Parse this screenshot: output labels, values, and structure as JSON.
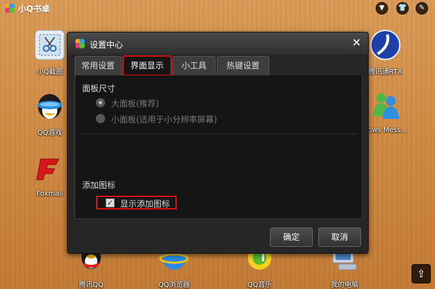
{
  "app": {
    "title": "小Q书桌"
  },
  "titlebar": {
    "icons": [
      "chevron-down-icon",
      "shirt-icon",
      "edit-icon"
    ]
  },
  "desktop": {
    "icons": [
      {
        "label": "小Q截图",
        "icon": "screenshot-icon"
      },
      {
        "label": "QQ游戏",
        "icon": "qq-game-icon"
      },
      {
        "label": "Foxmail",
        "icon": "foxmail-icon"
      },
      {
        "label": "腾讯通RTX",
        "icon": "rtx-icon"
      },
      {
        "label": "dows Mess...",
        "icon": "messenger-icon"
      },
      {
        "label": "腾讯QQ",
        "icon": "qq-penguin-icon"
      },
      {
        "label": "QQ浏览器",
        "icon": "qq-browser-icon"
      },
      {
        "label": "QQ音乐",
        "icon": "qq-music-icon"
      },
      {
        "label": "我的电脑",
        "icon": "computer-icon"
      }
    ]
  },
  "dialog": {
    "title": "设置中心",
    "tabs": [
      {
        "label": "常用设置",
        "active": false
      },
      {
        "label": "界面显示",
        "active": true
      },
      {
        "label": "小工具",
        "active": false
      },
      {
        "label": "热键设置",
        "active": false
      }
    ],
    "panel_size": {
      "title": "面板尺寸",
      "options": [
        {
          "label": "大面板(推荐)",
          "selected": true
        },
        {
          "label": "小面板(适用于小分辨率屏幕)",
          "selected": false
        }
      ]
    },
    "add_icon": {
      "title": "添加图标",
      "checkbox_label": "显示添加图标",
      "checked": true
    },
    "ok_label": "确定",
    "cancel_label": "取消",
    "colors": {
      "highlight": "#e01010",
      "background": "#262626"
    }
  }
}
